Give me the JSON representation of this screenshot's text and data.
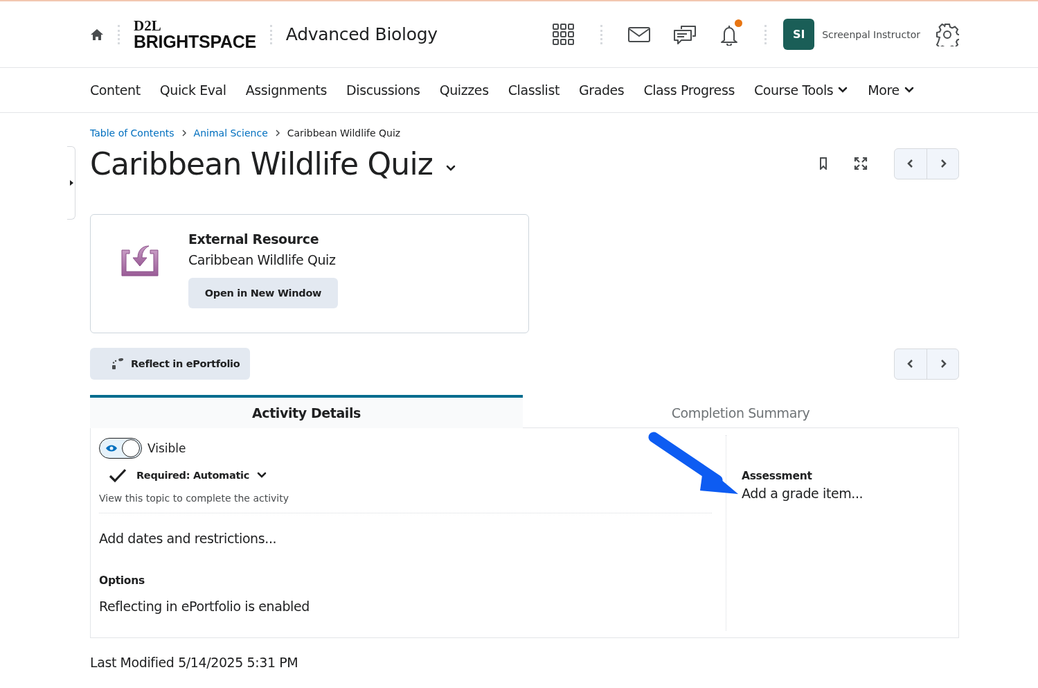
{
  "header": {
    "logo": {
      "top": "D2L",
      "bottom": "BRIGHTSPACE"
    },
    "course_title": "Advanced Biology",
    "notifications_unread": true,
    "user": {
      "initials": "SI",
      "name": "Screenpal Instructor"
    }
  },
  "nav": [
    {
      "label": "Content",
      "kind": "link"
    },
    {
      "label": "Quick Eval",
      "kind": "link"
    },
    {
      "label": "Assignments",
      "kind": "link"
    },
    {
      "label": "Discussions",
      "kind": "link"
    },
    {
      "label": "Quizzes",
      "kind": "link"
    },
    {
      "label": "Classlist",
      "kind": "link"
    },
    {
      "label": "Grades",
      "kind": "link"
    },
    {
      "label": "Class Progress",
      "kind": "link"
    },
    {
      "label": "Course Tools",
      "kind": "dropdown"
    },
    {
      "label": "More",
      "kind": "dropdown"
    }
  ],
  "breadcrumbs": [
    {
      "label": "Table of Contents",
      "kind": "link"
    },
    {
      "label": "Animal Science",
      "kind": "link"
    },
    {
      "label": "Caribbean Wildlife Quiz",
      "kind": "current"
    }
  ],
  "page_title": "Caribbean Wildlife Quiz",
  "resource_card": {
    "type_label": "External Resource",
    "name": "Caribbean Wildlife Quiz",
    "button": "Open in New Window"
  },
  "reflect_button": "Reflect in ePortfolio",
  "tabs": [
    {
      "label": "Activity Details",
      "selected": true
    },
    {
      "label": "Completion Summary",
      "selected": false
    }
  ],
  "details": {
    "visible_toggle": {
      "label": "Visible",
      "on": true
    },
    "requirement": "Required: Automatic",
    "requirement_hint": "View this topic to complete the activity",
    "dates_link": "Add dates and restrictions...",
    "options_heading": "Options",
    "options_text": "Reflecting in ePortfolio is enabled",
    "assessment_heading": "Assessment",
    "assessment_link": "Add a grade item..."
  },
  "last_modified": "Last Modified 5/14/2025 5:31 PM"
}
